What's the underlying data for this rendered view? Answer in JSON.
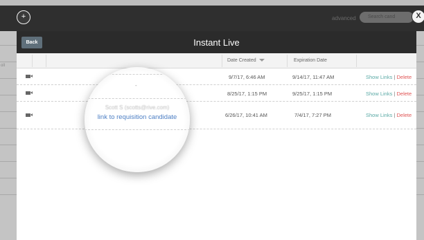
{
  "background": {
    "left_partial_text": "oll",
    "advanced_label": "advanced",
    "search_placeholder": "Search cand",
    "right_edge_text": "a"
  },
  "controls": {
    "plus_symbol": "+",
    "close_symbol": "X"
  },
  "modal": {
    "back_label": "Back",
    "title": "Instant Live",
    "columns": [
      "Date Created",
      "Expiration Date"
    ],
    "rows": [
      {
        "created": "9/7/17, 6:46 AM",
        "expires": "9/14/17, 11:47 AM",
        "show_links": "Show Links",
        "separator": "|",
        "delete": "Delete"
      },
      {
        "created": "8/25/17, 1:15 PM",
        "expires": "9/25/17, 1:15 PM",
        "show_links": "Show Links",
        "separator": "|",
        "delete": "Delete"
      },
      {
        "created": "6/26/17, 10:41 AM",
        "expires": "7/4/17, 7:27 PM",
        "show_links": "Show Links",
        "separator": "|",
        "delete": "Delete"
      }
    ]
  },
  "magnifier": {
    "dash": "-",
    "candidate_name": "Scott S (scotts@rive.com)",
    "link_text": "link to requisition candidate"
  }
}
